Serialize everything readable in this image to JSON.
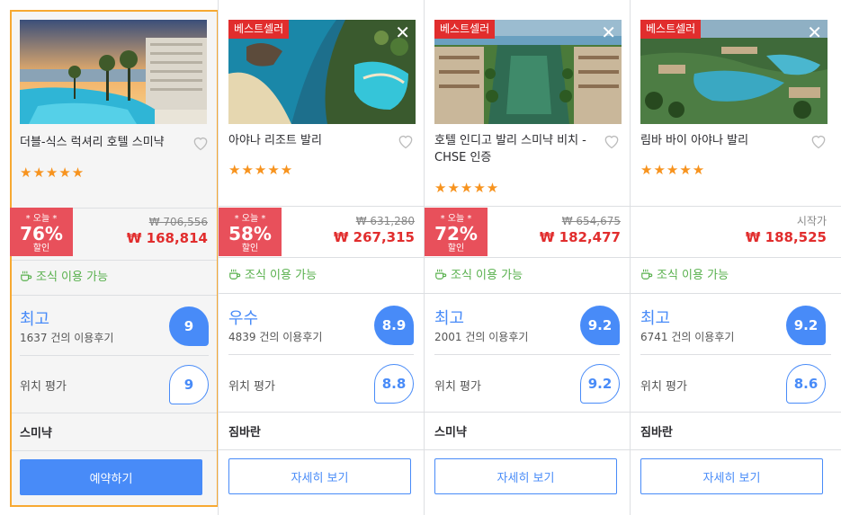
{
  "ui": {
    "close_glyph": "✕",
    "star_glyph": "★",
    "accent": "#488bf8",
    "deal_color": "#e8505b",
    "price_color": "#e12d2d",
    "breakfast_color": "#58b04d",
    "selected_border": "#f7a932"
  },
  "hotels": [
    {
      "name": "더블-식스 럭셔리 호텔 스미냑",
      "bestseller": "",
      "stars": 5,
      "deal_title": "* 오늘 *",
      "deal_percent": "76%",
      "deal_suffix": "할인",
      "original_price": "₩ 706,556",
      "from_label": "",
      "price": "₩ 168,814",
      "breakfast": "조식 이용 가능",
      "rating_label": "최고",
      "review_count": "1637 건의 이용후기",
      "score": "9",
      "location_label": "위치 평가",
      "location_score": "9",
      "area": "스미냑",
      "button": "예약하기",
      "selected": true
    },
    {
      "name": "아야나 리조트 발리",
      "bestseller": "베스트셀러",
      "stars": 5,
      "deal_title": "* 오늘 *",
      "deal_percent": "58%",
      "deal_suffix": "할인",
      "original_price": "₩ 631,280",
      "from_label": "",
      "price": "₩ 267,315",
      "breakfast": "조식 이용 가능",
      "rating_label": "우수",
      "review_count": "4839 건의 이용후기",
      "score": "8.9",
      "location_label": "위치 평가",
      "location_score": "8.8",
      "area": "짐바란",
      "button": "자세히 보기",
      "selected": false
    },
    {
      "name": "호텔 인디고 발리 스미냑 비치 - CHSE 인증",
      "bestseller": "베스트셀러",
      "stars": 5,
      "deal_title": "* 오늘 *",
      "deal_percent": "72%",
      "deal_suffix": "할인",
      "original_price": "₩ 654,675",
      "from_label": "",
      "price": "₩ 182,477",
      "breakfast": "조식 이용 가능",
      "rating_label": "최고",
      "review_count": "2001 건의 이용후기",
      "score": "9.2",
      "location_label": "위치 평가",
      "location_score": "9.2",
      "area": "스미냑",
      "button": "자세히 보기",
      "selected": false
    },
    {
      "name": "림바 바이 아야나 발리",
      "bestseller": "베스트셀러",
      "stars": 5,
      "deal_title": "",
      "deal_percent": "",
      "deal_suffix": "",
      "original_price": "",
      "from_label": "시작가",
      "price": "₩ 188,525",
      "breakfast": "조식 이용 가능",
      "rating_label": "최고",
      "review_count": "6741 건의 이용후기",
      "score": "9.2",
      "location_label": "위치 평가",
      "location_score": "8.6",
      "area": "짐바란",
      "button": "자세히 보기",
      "selected": false
    }
  ]
}
